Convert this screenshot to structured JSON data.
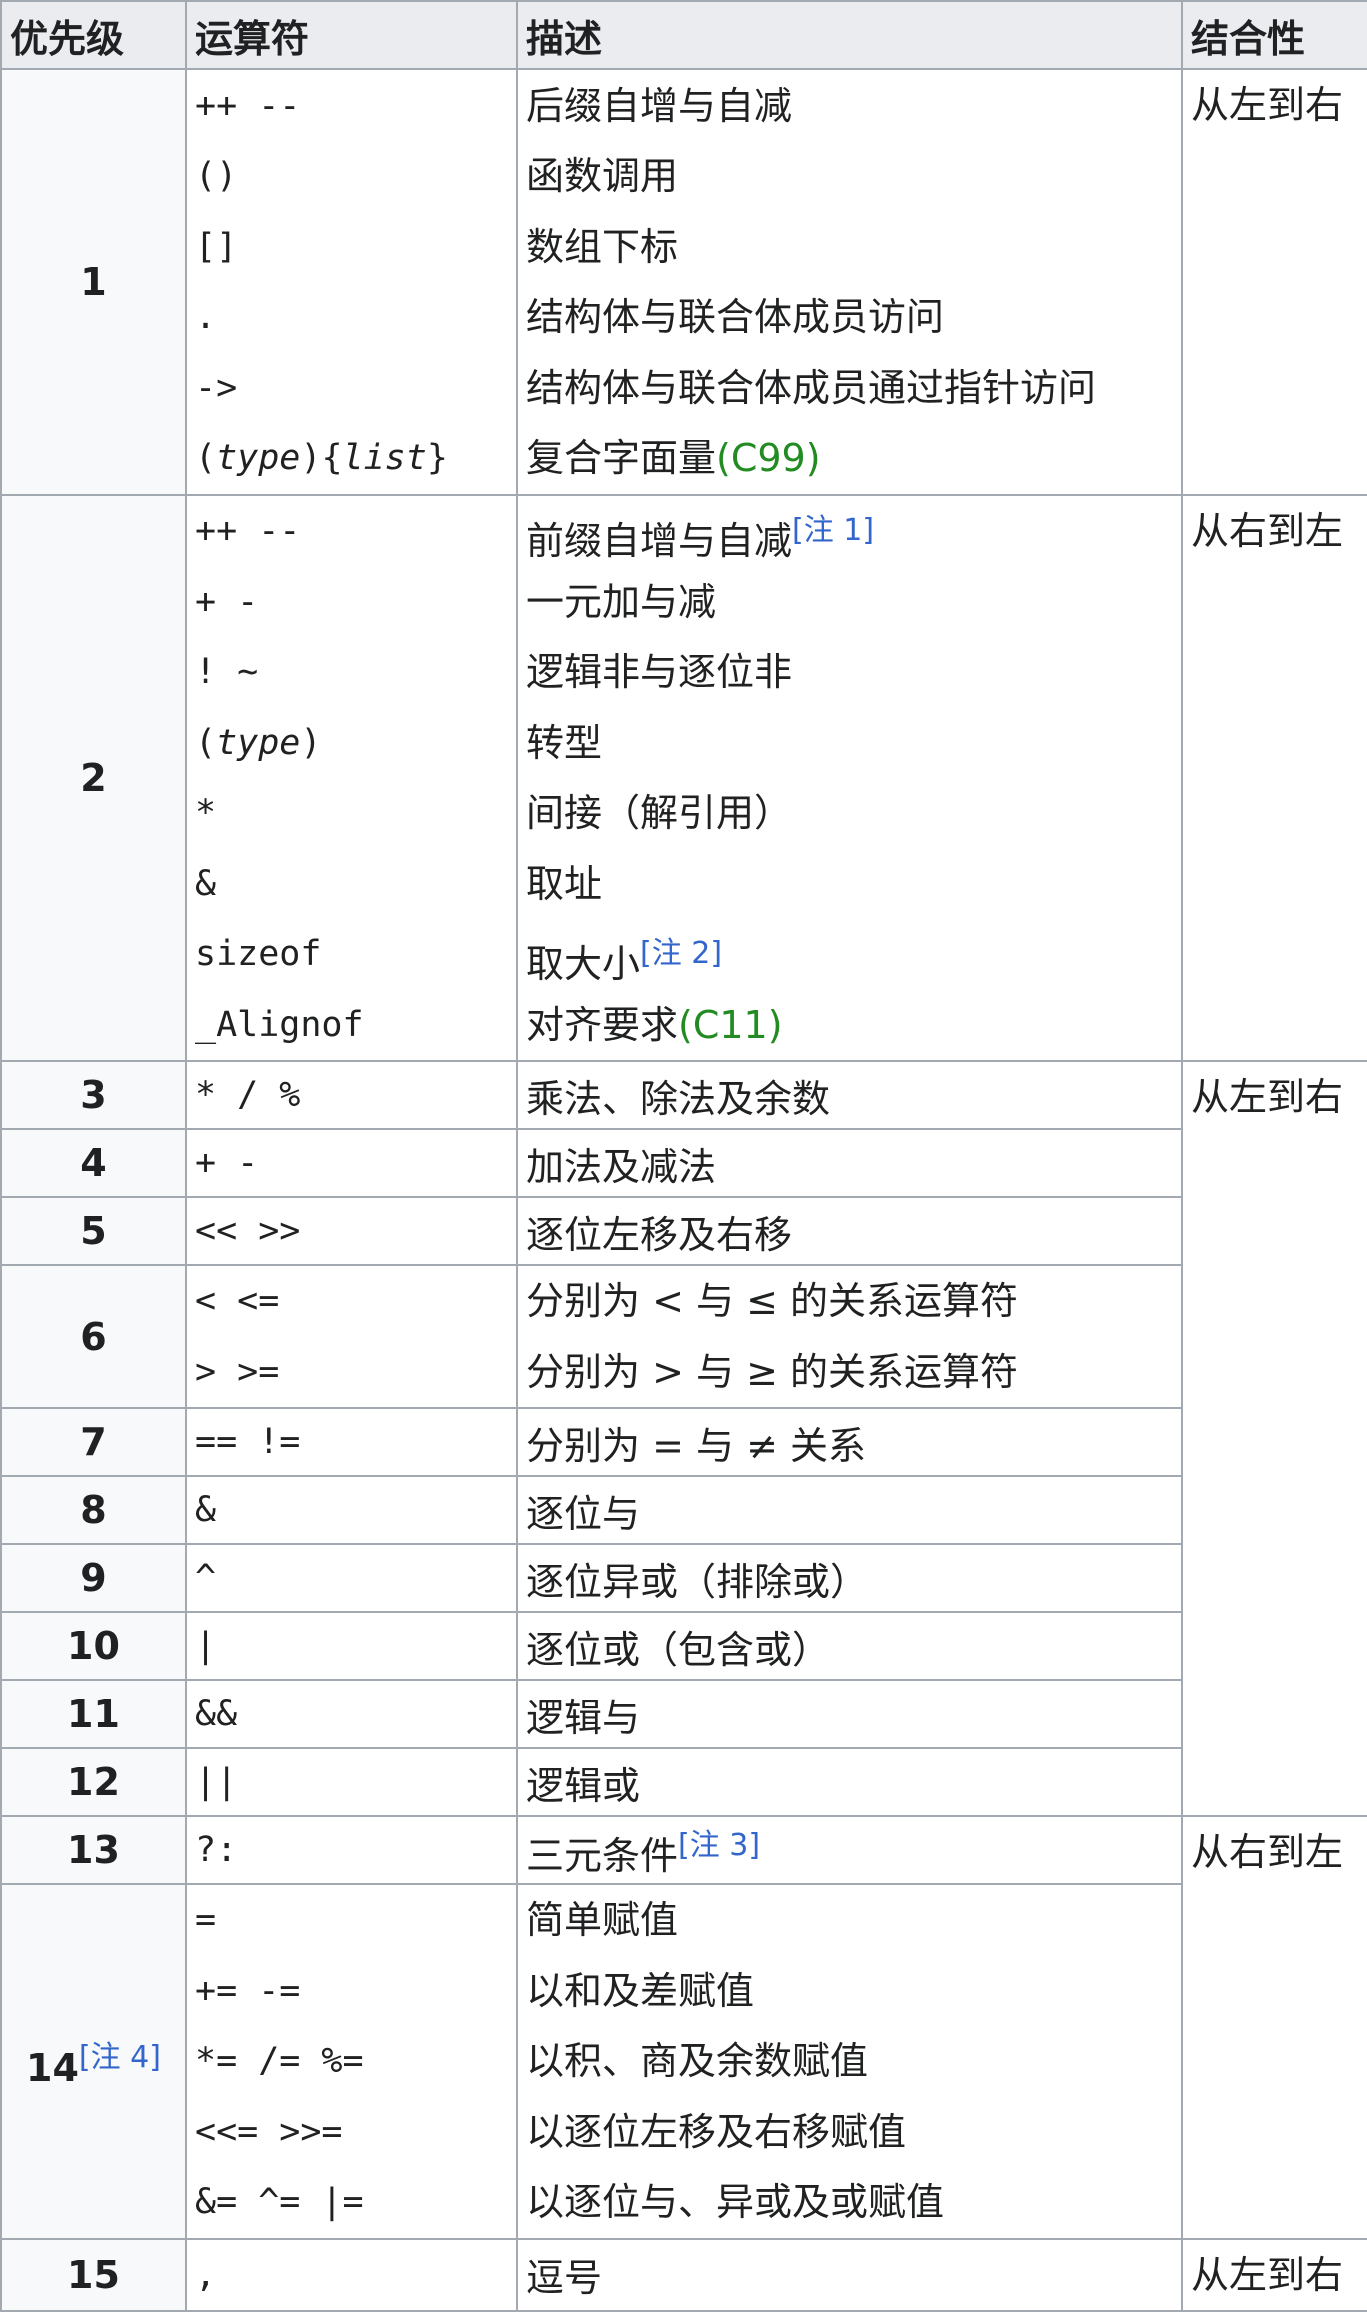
{
  "headers": {
    "level": "优先级",
    "operator": "运算符",
    "description": "描述",
    "associativity": "结合性"
  },
  "groups": [
    {
      "level": "1",
      "associativity": "从左到右",
      "ops": [
        "++ --",
        "()",
        "[]",
        ".",
        "->",
        "(type){list}"
      ],
      "descs": [
        "后缀自增与自减",
        "函数调用",
        "数组下标",
        "结构体与联合体成员访问",
        "结构体与联合体成员通过指针访问",
        "复合字面量"
      ],
      "desc_tags": [
        "",
        "",
        "",
        "",
        "",
        "(C99)"
      ],
      "desc_notes": [
        "",
        "",
        "",
        "",
        "",
        ""
      ]
    },
    {
      "level": "2",
      "associativity": "从右到左",
      "ops": [
        "++ --",
        "+ -",
        "! ~",
        "(type)",
        "*",
        "&",
        "sizeof",
        "_Alignof"
      ],
      "descs": [
        "前缀自增与自减",
        "一元加与减",
        "逻辑非与逐位非",
        "转型",
        "间接（解引用）",
        "取址",
        "取大小",
        "对齐要求"
      ],
      "desc_tags": [
        "",
        "",
        "",
        "",
        "",
        "",
        "",
        "(C11)"
      ],
      "desc_notes": [
        "[注 1]",
        "",
        "",
        "",
        "",
        "",
        "[注 2]",
        ""
      ]
    },
    {
      "level": "3",
      "associativity": "从左到右",
      "ops": [
        "* / %"
      ],
      "descs": [
        "乘法、除法及余数"
      ]
    },
    {
      "level": "4",
      "ops": [
        "+ -"
      ],
      "descs": [
        "加法及减法"
      ]
    },
    {
      "level": "5",
      "ops": [
        "<< >>"
      ],
      "descs": [
        "逐位左移及右移"
      ]
    },
    {
      "level": "6",
      "ops": [
        "< <=",
        "> >="
      ],
      "descs": [
        "分别为 < 与 ≤ 的关系运算符",
        "分别为 > 与 ≥ 的关系运算符"
      ]
    },
    {
      "level": "7",
      "ops": [
        "== !="
      ],
      "descs": [
        "分别为 = 与 ≠ 关系"
      ]
    },
    {
      "level": "8",
      "ops": [
        "&"
      ],
      "descs": [
        "逐位与"
      ]
    },
    {
      "level": "9",
      "ops": [
        "^"
      ],
      "descs": [
        "逐位异或（排除或）"
      ]
    },
    {
      "level": "10",
      "ops": [
        "|"
      ],
      "descs": [
        "逐位或（包含或）"
      ]
    },
    {
      "level": "11",
      "ops": [
        "&&"
      ],
      "descs": [
        "逻辑与"
      ]
    },
    {
      "level": "12",
      "ops": [
        "||"
      ],
      "descs": [
        "逻辑或"
      ]
    },
    {
      "level": "13",
      "associativity": "从右到左",
      "ops": [
        "?:"
      ],
      "descs": [
        "三元条件"
      ],
      "desc_notes": [
        "[注 3]"
      ]
    },
    {
      "level": "14",
      "level_note": "[注 4]",
      "ops": [
        "=",
        "+= -=",
        "*= /= %=",
        "<<= >>=",
        "&= ^= |="
      ],
      "descs": [
        "简单赋值",
        "以和及差赋值",
        "以积、商及余数赋值",
        "以逐位左移及右移赋值",
        "以逐位与、异或及或赋值"
      ]
    },
    {
      "level": "15",
      "associativity": "从左到右",
      "ops": [
        ","
      ],
      "descs": [
        "逗号"
      ]
    }
  ],
  "colors": {
    "header_bg": "#eaecf0",
    "level_bg": "#f8f9fa",
    "border": "#a2a9b1",
    "note": "#3366cc",
    "std_tag": "#228b22"
  }
}
